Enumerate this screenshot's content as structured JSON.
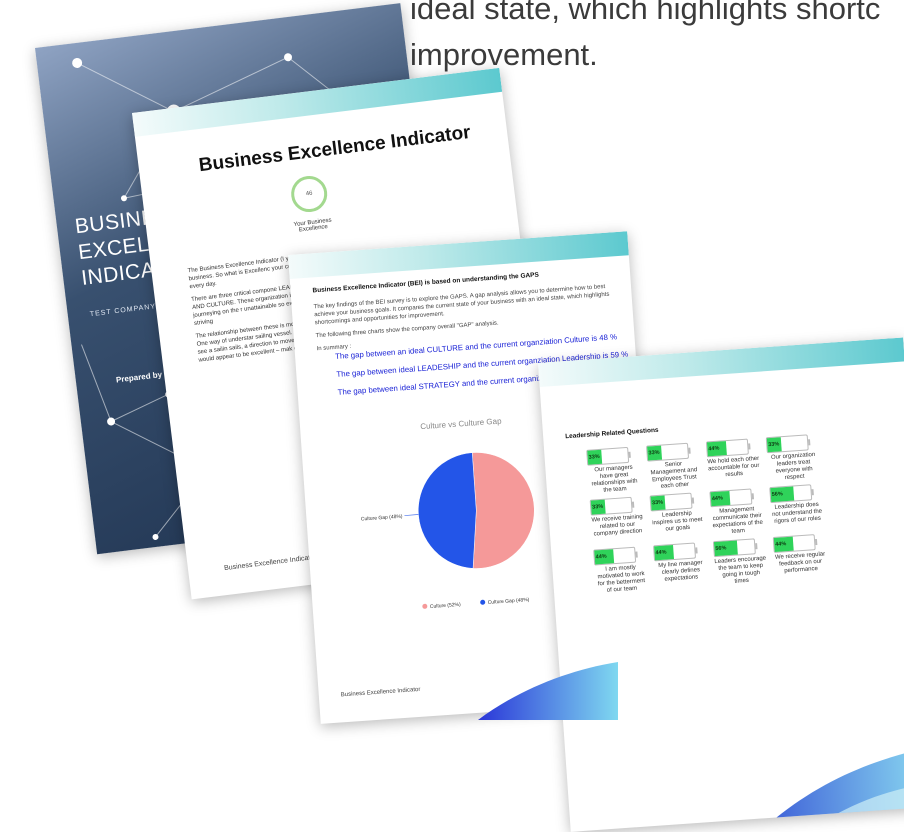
{
  "background_text": {
    "line1": "ideal state, which highlights shortc",
    "line2": "improvement."
  },
  "cover": {
    "title_lines": [
      "BUSINESS",
      "EXCELLENC",
      "INDICATOR"
    ],
    "company": "TEST COMPANY",
    "prepared_by": "Prepared by Rael Bricker"
  },
  "page2": {
    "title": "Business Excellence Indicator",
    "score_label": "46",
    "score_caption": "Your Business Excellence",
    "body": [
      "The Business Excellence Indicator (I your business. So what is Excellenc your company) every day.",
      "There are three critical compone LEADERSHIP AND CULTURE. These organization in journeying on the r unattainable so excellence is striving",
      "The relationship between these is moving parts. One way of understar sailing vessel. When you see a sailin sails, a direction to move and som would appear to be excellent – mak of itself."
    ],
    "circle_label": "LE",
    "footer": "Business Excellence Indicator"
  },
  "page3": {
    "heading": "Business Excellence Indicator (BEI) is based on understanding the GAPS",
    "paragraphs": [
      "The key findings of the BEI survey is to explore the GAPS. A gap analysis allows you to determine how to best achieve your business goals. It compares the current state of your business with an ideal state, which highlights shortcomings and opportunities for improvement.",
      "The following three charts show the company overall \"GAP\" analysis.",
      "In summary :"
    ],
    "gaps": [
      "The gap between an ideal CULTURE and the current organziation Culture is 48 %",
      "The gap between ideal LEADESHIP and the current organziation Leadership is 59 %",
      "The gap between ideal STRATEGY and the current organization Strategy is 54 %"
    ],
    "footer": "Business Excellence Indicator"
  },
  "chart_data": {
    "type": "pie",
    "title": "Culture vs Culture Gap",
    "labels": [
      "Culture (52%)",
      "Culture Gap (48%)"
    ],
    "values": [
      52,
      48
    ],
    "colors": [
      "#f59999",
      "#2355e8"
    ],
    "callout": "Culture Gap (48%)",
    "legend_position": "bottom"
  },
  "page4": {
    "title": "Leadership Related Questions",
    "questions": [
      {
        "pct": 33,
        "label": "33%",
        "text": "Our managers have great relationships with the team"
      },
      {
        "pct": 33,
        "label": "33%",
        "text": "Senior Management and Employees Trust each other"
      },
      {
        "pct": 44,
        "label": "44%",
        "text": "We hold each other accountable for our results"
      },
      {
        "pct": 33,
        "label": "33%",
        "text": "Our organization leaders treat everyone with respect"
      },
      {
        "pct": 33,
        "label": "33%",
        "text": "We receive training related to our company direction"
      },
      {
        "pct": 33,
        "label": "33%",
        "text": "Leadership inspires us to meet our goals"
      },
      {
        "pct": 44,
        "label": "44%",
        "text": "Management communicate their expectations of the team"
      },
      {
        "pct": 56,
        "label": "56%",
        "text": "Leadership does not understand the rigors of our roles"
      },
      {
        "pct": 44,
        "label": "44%",
        "text": "I am mostly motivated to work for the betterment of our team"
      },
      {
        "pct": 44,
        "label": "44%",
        "text": "My line manager clearly defines expectations"
      },
      {
        "pct": 56,
        "label": "56%",
        "text": "Leaders encourage the team to keep going in tough times"
      },
      {
        "pct": 44,
        "label": "44%",
        "text": "We receive regular feedback on our performance"
      }
    ]
  }
}
